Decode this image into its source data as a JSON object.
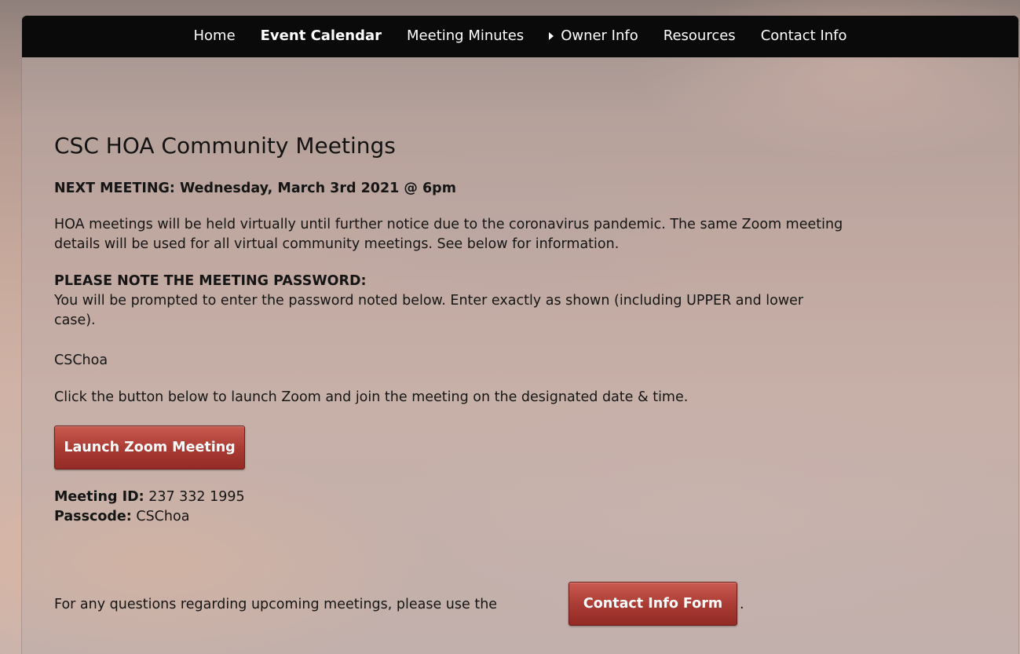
{
  "nav": {
    "items": [
      {
        "label": "Home",
        "active": false,
        "submenu": false
      },
      {
        "label": "Event Calendar",
        "active": true,
        "submenu": false
      },
      {
        "label": "Meeting Minutes",
        "active": false,
        "submenu": false
      },
      {
        "label": "Owner Info",
        "active": false,
        "submenu": true
      },
      {
        "label": "Resources",
        "active": false,
        "submenu": false
      },
      {
        "label": "Contact Info",
        "active": false,
        "submenu": false
      }
    ]
  },
  "page": {
    "title": "CSC HOA Community Meetings",
    "next_meeting": "NEXT MEETING: Wednesday, March 3rd 2021 @ 6pm",
    "intro_line1": "HOA meetings will be held virtually until further notice due to the coronavirus pandemic. The same Zoom meeting",
    "intro_line2": "details will be used for all virtual community meetings. See below for information.",
    "password_heading": "PLEASE NOTE THE MEETING PASSWORD:",
    "password_line1": "You will be prompted to enter the password noted below. Enter exactly as shown (including UPPER and lower",
    "password_line2": "case).",
    "password_value": "CSChoa",
    "launch_instructions": "Click the button below to launch Zoom and join the meeting on the designated date & time.",
    "launch_button": "Launch Zoom Meeting",
    "meeting_id_label": "Meeting ID:",
    "meeting_id_value": " 237 332 1995",
    "passcode_label": "Passcode:",
    "passcode_value": " CSChoa",
    "questions_text": "For any questions regarding upcoming meetings, please use the",
    "contact_button": "Contact Info Form",
    "questions_suffix": "."
  },
  "colors": {
    "navbar": "#0a0a0a",
    "button": "#a83a33",
    "text": "#151515"
  }
}
